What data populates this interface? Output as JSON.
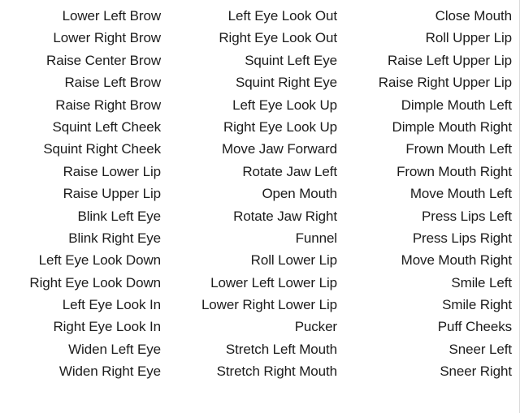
{
  "panel": {
    "name": "face-blend-shape-list",
    "background_color": "#ffffff",
    "text_color": "#1c1c1c",
    "border_color": "#d9d9d9",
    "row_count": 18,
    "column_count": 3,
    "total_items": 54
  },
  "columns": [
    {
      "name": "column-1",
      "items": [
        "Lower Left Brow",
        "Lower Right Brow",
        "Raise Center Brow",
        "Raise Left Brow",
        "Raise Right Brow",
        "Squint Left Cheek",
        "Squint Right Cheek",
        "Raise Lower Lip",
        "Raise Upper Lip",
        "Blink Left Eye",
        "Blink Right Eye",
        "Left Eye Look Down",
        "Right Eye Look Down",
        "Left Eye Look In",
        "Right Eye Look In",
        "Widen Left Eye",
        "Widen Right Eye"
      ]
    },
    {
      "name": "column-2",
      "items": [
        "Left Eye Look Out",
        "Right Eye Look Out",
        "Squint Left Eye",
        "Squint Right Eye",
        "Left Eye Look Up",
        "Right Eye Look Up",
        "Move Jaw Forward",
        "Rotate Jaw Left",
        "Open Mouth",
        "Rotate Jaw Right",
        "Funnel",
        "Roll Lower Lip",
        "Lower Left Lower Lip",
        "Lower Right Lower Lip",
        "Pucker",
        "Stretch Left Mouth",
        "Stretch Right Mouth"
      ]
    },
    {
      "name": "column-3",
      "items": [
        "Close Mouth",
        "Roll Upper Lip",
        "Raise Left Upper Lip",
        "Raise Right Upper Lip",
        "Dimple Mouth Left",
        "Dimple Mouth Right",
        "Frown Mouth Left",
        "Frown Mouth Right",
        "Move Mouth Left",
        "Press Lips Left",
        "Press Lips Right",
        "Move Mouth Right",
        "Smile Left",
        "Smile Right",
        "Puff Cheeks",
        "Sneer Left",
        "Sneer Right"
      ]
    }
  ]
}
